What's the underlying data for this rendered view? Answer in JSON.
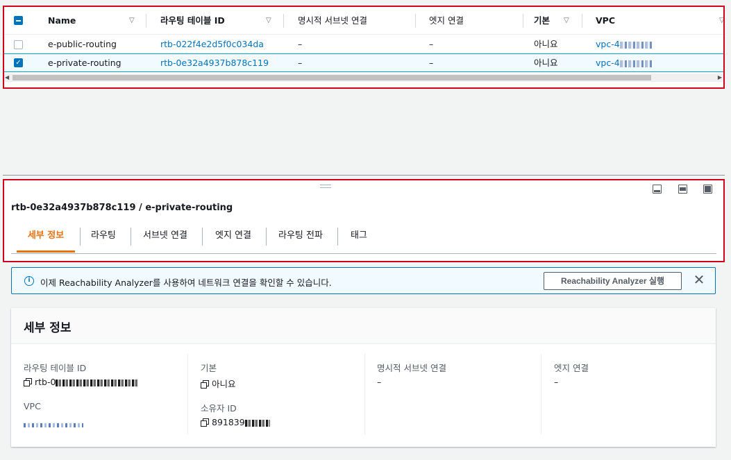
{
  "table": {
    "columns": [
      {
        "label": "Name"
      },
      {
        "label": "라우팅 테이블 ID"
      },
      {
        "label": "명시적 서브넷 연결"
      },
      {
        "label": "엣지 연결"
      },
      {
        "label": "기본"
      },
      {
        "label": "VPC"
      }
    ],
    "rows": [
      {
        "name": "e-public-routing",
        "id": "rtb-022f4e2d5f0c034da",
        "subnet": "–",
        "edge": "–",
        "main": "아니요",
        "vpc": "vpc-4",
        "selected": false
      },
      {
        "name": "e-private-routing",
        "id": "rtb-0e32a4937b878c119",
        "subnet": "–",
        "edge": "–",
        "main": "아니요",
        "vpc": "vpc-4",
        "selected": true
      }
    ]
  },
  "detail": {
    "title": "rtb-0e32a4937b878c119 / e-private-routing",
    "tabs": [
      {
        "label": "세부 정보",
        "active": true
      },
      {
        "label": "라우팅"
      },
      {
        "label": "서브넷 연결"
      },
      {
        "label": "엣지 연결"
      },
      {
        "label": "라우팅 전파"
      },
      {
        "label": "태그"
      }
    ]
  },
  "alert": {
    "text": "이제 Reachability Analyzer를 사용하여 네트워크 연결을 확인할 수 있습니다.",
    "button": "Reachability Analyzer 실행"
  },
  "details": {
    "title": "세부 정보",
    "rtb_label": "라우팅 테이블 ID",
    "rtb_value": "rtb-0",
    "main_label": "기본",
    "main_value": "아니요",
    "subnet_label": "명시적 서브넷 연결",
    "subnet_value": "–",
    "edge_label": "엣지 연결",
    "edge_value": "–",
    "vpc_label": "VPC",
    "owner_label": "소유자 ID",
    "owner_value": "891839"
  },
  "colors": {
    "link": "#0073bb",
    "active_tab": "#ec7211",
    "highlight_border": "#d0021b",
    "selected_row": "#f1faff"
  }
}
